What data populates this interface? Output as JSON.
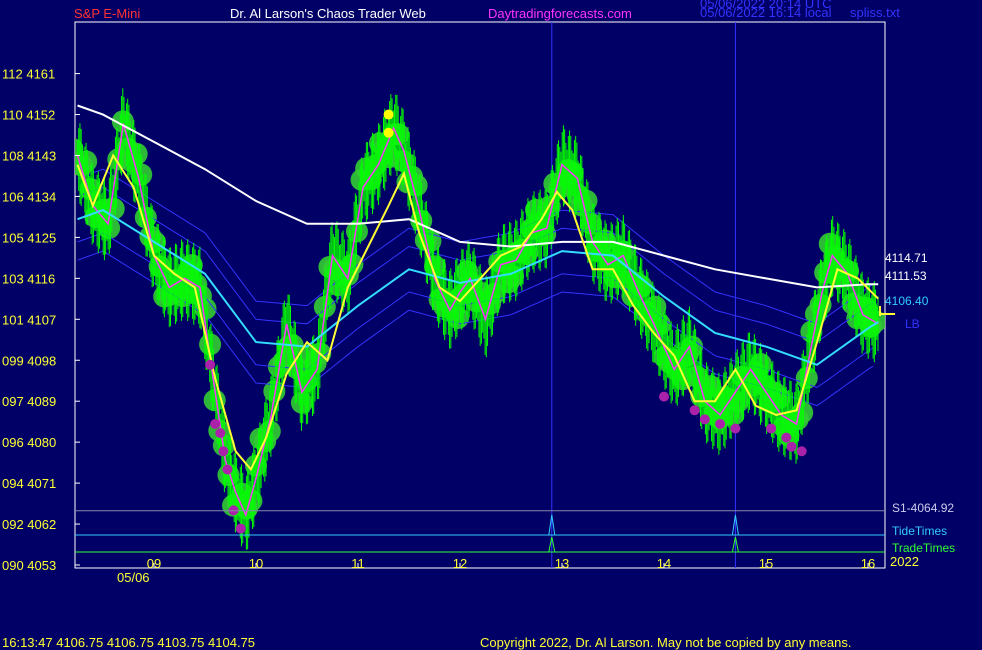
{
  "header": {
    "symbol": "S&P E-Mini",
    "author": "Dr. Al Larson's Chaos Trader Web",
    "site": "Daytradingforecasts.com",
    "stamp_utc": "05/06/2022 20:14 UTC",
    "stamp_local": "05/06/2022 16:14 local",
    "file": "spliss.txt"
  },
  "footer": {
    "quote": "16:13:47  4106.75 4106.75 4103.75 4104.75",
    "copyright": "Copyright 2022, Dr. Al Larson. May not be copied by any means."
  },
  "colors": {
    "background": "#000066",
    "plot_border": "#ffffff",
    "price_bars": "#00ff00",
    "glow": "#33cc33",
    "white_ma": "#ffffff",
    "cyan_ma": "#33ddff",
    "yellow_ma": "#ffff33",
    "magenta_line": "#ff33ff",
    "blue_band": "#3333ff",
    "marker_yellow": "#ffff00",
    "marker_magenta": "#aa22aa",
    "header_red": "#ff3333",
    "header_white": "#ffffff",
    "header_magenta": "#ff33ff",
    "axis_text": "#ffff33",
    "right_label_white": "#ffffff",
    "right_label_cyan": "#33ccff",
    "right_label_green": "#33ff33"
  },
  "chart_data": {
    "type": "line",
    "title": "S&P E-Mini",
    "x_hours": [
      9,
      10,
      11,
      12,
      13,
      14,
      15,
      16
    ],
    "x_tick_labels": [
      "09",
      "10",
      "11",
      "12",
      "13",
      "14",
      "15",
      "16"
    ],
    "date_label": "05/06",
    "year_label": "2022",
    "xlim": [
      8.25,
      16.1
    ],
    "ylim": [
      4053,
      4161
    ],
    "y_ticks": [
      {
        "price": 4161,
        "label": "112 4161"
      },
      {
        "price": 4152,
        "label": "110 4152"
      },
      {
        "price": 4143,
        "label": "108 4143"
      },
      {
        "price": 4134,
        "label": "106 4134"
      },
      {
        "price": 4125,
        "label": "105 4125"
      },
      {
        "price": 4116,
        "label": "103 4116"
      },
      {
        "price": 4107,
        "label": "101 4107"
      },
      {
        "price": 4098,
        "label": "099 4098"
      },
      {
        "price": 4089,
        "label": "097 4089"
      },
      {
        "price": 4080,
        "label": "096 4080"
      },
      {
        "price": 4071,
        "label": "094 4071"
      },
      {
        "price": 4062,
        "label": "092 4062"
      },
      {
        "price": 4053,
        "label": "090 4053"
      }
    ],
    "series": [
      {
        "name": "price",
        "x": [
          8.25,
          8.4,
          8.55,
          8.7,
          8.85,
          9.0,
          9.15,
          9.3,
          9.45,
          9.6,
          9.7,
          9.8,
          9.9,
          10.0,
          10.15,
          10.3,
          10.45,
          10.6,
          10.75,
          10.9,
          11.05,
          11.2,
          11.35,
          11.45,
          11.6,
          11.75,
          11.9,
          12.0,
          12.1,
          12.25,
          12.4,
          12.55,
          12.7,
          12.85,
          13.0,
          13.15,
          13.3,
          13.45,
          13.6,
          13.75,
          13.9,
          14.0,
          14.1,
          14.25,
          14.4,
          14.55,
          14.7,
          14.85,
          15.0,
          15.15,
          15.3,
          15.4,
          15.55,
          15.65,
          15.8,
          15.95,
          16.1
        ],
        "y": [
          4143,
          4132,
          4128,
          4150,
          4138,
          4121,
          4114,
          4116,
          4114,
          4091,
          4076,
          4069,
          4064,
          4072,
          4086,
          4106,
          4091,
          4096,
          4121,
          4116,
          4136,
          4141,
          4149,
          4144,
          4131,
          4116,
          4109,
          4113,
          4116,
          4107,
          4119,
          4120,
          4126,
          4127,
          4141,
          4138,
          4124,
          4119,
          4121,
          4113,
          4106,
          4101,
          4096,
          4101,
          4089,
          4086,
          4091,
          4096,
          4091,
          4086,
          4084,
          4096,
          4113,
          4121,
          4117,
          4108,
          4106
        ]
      },
      {
        "name": "white MA",
        "x": [
          8.25,
          8.5,
          9.0,
          9.5,
          10.0,
          10.5,
          11.0,
          11.5,
          12.0,
          12.5,
          13.0,
          13.5,
          14.0,
          14.5,
          15.0,
          15.5,
          16.0,
          16.1
        ],
        "y": [
          4154,
          4152,
          4146,
          4140,
          4133,
          4128,
          4128,
          4129,
          4124,
          4123,
          4124,
          4124,
          4121,
          4118,
          4116,
          4114,
          4114.71,
          4114.71
        ]
      },
      {
        "name": "cyan MA",
        "x": [
          8.25,
          8.5,
          9.0,
          9.5,
          10.0,
          10.5,
          11.0,
          11.5,
          12.0,
          12.5,
          13.0,
          13.5,
          14.0,
          14.5,
          15.0,
          15.5,
          16.0,
          16.1
        ],
        "y": [
          4129,
          4131,
          4124,
          4117,
          4102,
          4101,
          4110,
          4118,
          4115,
          4117,
          4122,
          4121,
          4112,
          4104,
          4101,
          4097,
          4105,
          4106.4
        ]
      },
      {
        "name": "yellow MA",
        "x": [
          8.25,
          8.4,
          8.6,
          8.8,
          9.0,
          9.2,
          9.4,
          9.6,
          9.8,
          9.95,
          10.1,
          10.3,
          10.5,
          10.7,
          10.9,
          11.1,
          11.3,
          11.45,
          11.6,
          11.8,
          12.0,
          12.2,
          12.4,
          12.6,
          12.8,
          12.95,
          13.1,
          13.3,
          13.5,
          13.7,
          13.9,
          14.1,
          14.3,
          14.5,
          14.7,
          14.9,
          15.1,
          15.3,
          15.5,
          15.7,
          15.9,
          16.1
        ],
        "y": [
          4141,
          4132,
          4143,
          4136,
          4121,
          4117,
          4114,
          4094,
          4078,
          4074,
          4081,
          4095,
          4102,
          4098,
          4114,
          4123,
          4132,
          4139,
          4126,
          4114,
          4111,
          4116,
          4121,
          4123,
          4129,
          4135,
          4131,
          4118,
          4118,
          4110,
          4104,
          4099,
          4089,
          4089,
          4096,
          4088,
          4086,
          4087,
          4102,
          4118,
          4116,
          4111.53
        ]
      }
    ],
    "yellow_markers": [
      {
        "x": 11.3,
        "y": 4152
      },
      {
        "x": 11.3,
        "y": 4148
      }
    ],
    "magenta_markers": [
      {
        "x": 9.55,
        "y": 4097
      },
      {
        "x": 9.6,
        "y": 4084
      },
      {
        "x": 9.65,
        "y": 4082
      },
      {
        "x": 9.68,
        "y": 4078
      },
      {
        "x": 9.72,
        "y": 4074
      },
      {
        "x": 9.78,
        "y": 4065
      },
      {
        "x": 9.85,
        "y": 4061
      },
      {
        "x": 14.0,
        "y": 4090
      },
      {
        "x": 14.3,
        "y": 4087
      },
      {
        "x": 14.4,
        "y": 4085
      },
      {
        "x": 14.55,
        "y": 4084
      },
      {
        "x": 14.7,
        "y": 4083
      },
      {
        "x": 15.05,
        "y": 4083
      },
      {
        "x": 15.2,
        "y": 4081
      },
      {
        "x": 15.25,
        "y": 4079
      },
      {
        "x": 15.35,
        "y": 4078
      }
    ],
    "vertical_lines_x": [
      12.9,
      14.7
    ],
    "right_labels": {
      "white": "4114.71",
      "yellow": "4111.53",
      "cyan": "4106.40",
      "lb": "LB"
    },
    "s1_level": {
      "label": "S1-4064.92",
      "value": 4064.92
    },
    "tide_label": "TideTimes",
    "trade_label": "TradeTimes",
    "tide_spikes_x": [
      12.9,
      14.7
    ]
  }
}
